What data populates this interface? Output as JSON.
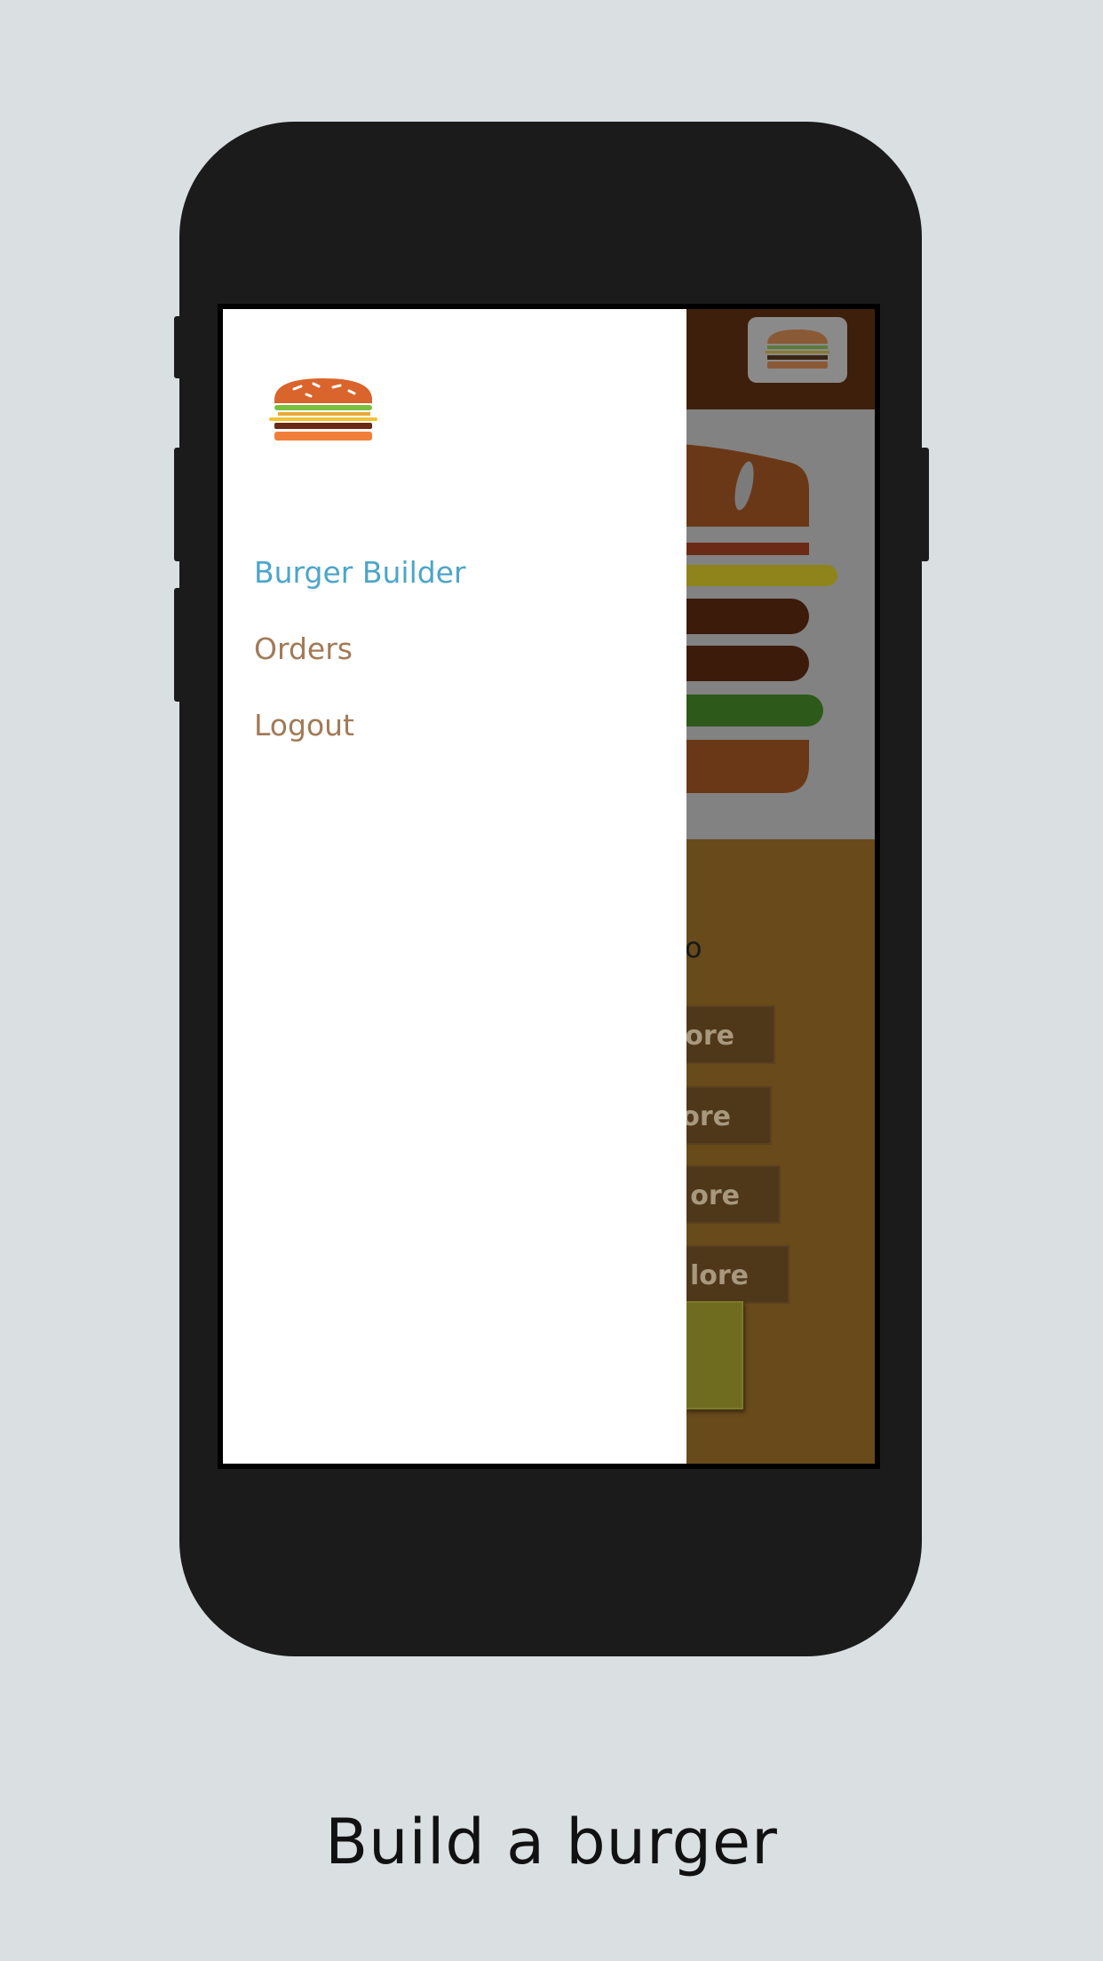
{
  "drawer": {
    "logo_icon": "burger-logo-icon",
    "nav": [
      {
        "label": "Burger Builder",
        "active": true
      },
      {
        "label": "Orders",
        "active": false
      },
      {
        "label": "Logout",
        "active": false
      }
    ]
  },
  "background_app": {
    "toolbar_logo_icon": "burger-logo-icon",
    "price_fragment": "o",
    "control_buttons": [
      "ore",
      "ore",
      "ore",
      "lore"
    ]
  },
  "caption": "Build a burger",
  "colors": {
    "active_nav": "#4da5c9",
    "nav": "#a27a57",
    "toolbar": "#3e1f0b",
    "controls_bg": "#684a1b",
    "page_bg": "#dadfe2",
    "phone_body": "#1b1b1b"
  }
}
